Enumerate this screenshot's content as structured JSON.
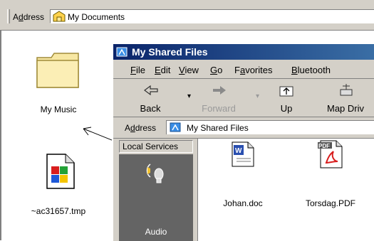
{
  "outer": {
    "address_label": "Address",
    "address_value": "My Documents"
  },
  "desktop": {
    "items": [
      {
        "label": "My Music",
        "icon": "folder-icon"
      },
      {
        "label": "~ac31657.tmp",
        "icon": "file-icon"
      }
    ]
  },
  "inner": {
    "title": "My Shared Files",
    "menu": [
      "File",
      "Edit",
      "View",
      "Go",
      "Favorites",
      "Bluetooth"
    ],
    "menu_underline": [
      "F",
      "E",
      "V",
      "G",
      "a",
      "B"
    ],
    "toolbar": {
      "back": "Back",
      "forward": "Forward",
      "up": "Up",
      "map": "Map Driv"
    },
    "address_label": "Address",
    "address_value": "My Shared Files",
    "local_services": "Local Services",
    "audio_label": "Audio",
    "files": [
      {
        "label": "Johan.doc",
        "icon": "word-document-icon"
      },
      {
        "label": "Torsdag.PDF",
        "icon": "pdf-document-icon"
      }
    ]
  }
}
